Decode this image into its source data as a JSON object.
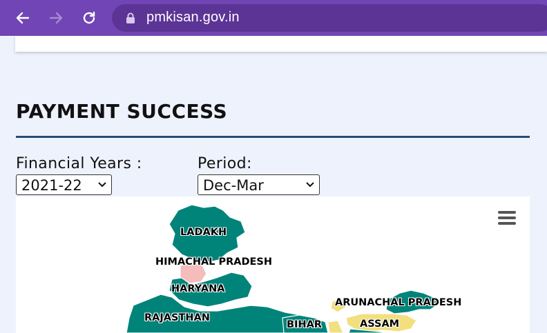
{
  "browser": {
    "url": "pmkisan.gov.in",
    "back_icon": "arrow-left-icon",
    "forward_icon": "arrow-right-icon",
    "reload_icon": "reload-icon",
    "lock_icon": "lock-icon"
  },
  "section": {
    "title": "PAYMENT SUCCESS"
  },
  "filters": {
    "financial_years_label": "Financial Years :",
    "financial_years_value": "2021-22",
    "period_label": "Period:",
    "period_value": "Dec-Mar"
  },
  "map": {
    "menu_icon": "hamburger-menu-icon",
    "states": {
      "ladakh": "LADAKH",
      "himachal": "HIMACHAL PRADESH",
      "haryana": "HARYANA",
      "rajasthan": "RAJASTHAN",
      "arunachal": "ARUNACHAL PRADESH",
      "assam": "ASSAM",
      "bihar": "BIHAR"
    },
    "colors": {
      "green": "#00847a",
      "pink": "#f5bcbc",
      "yellow": "#f2df7e"
    }
  }
}
